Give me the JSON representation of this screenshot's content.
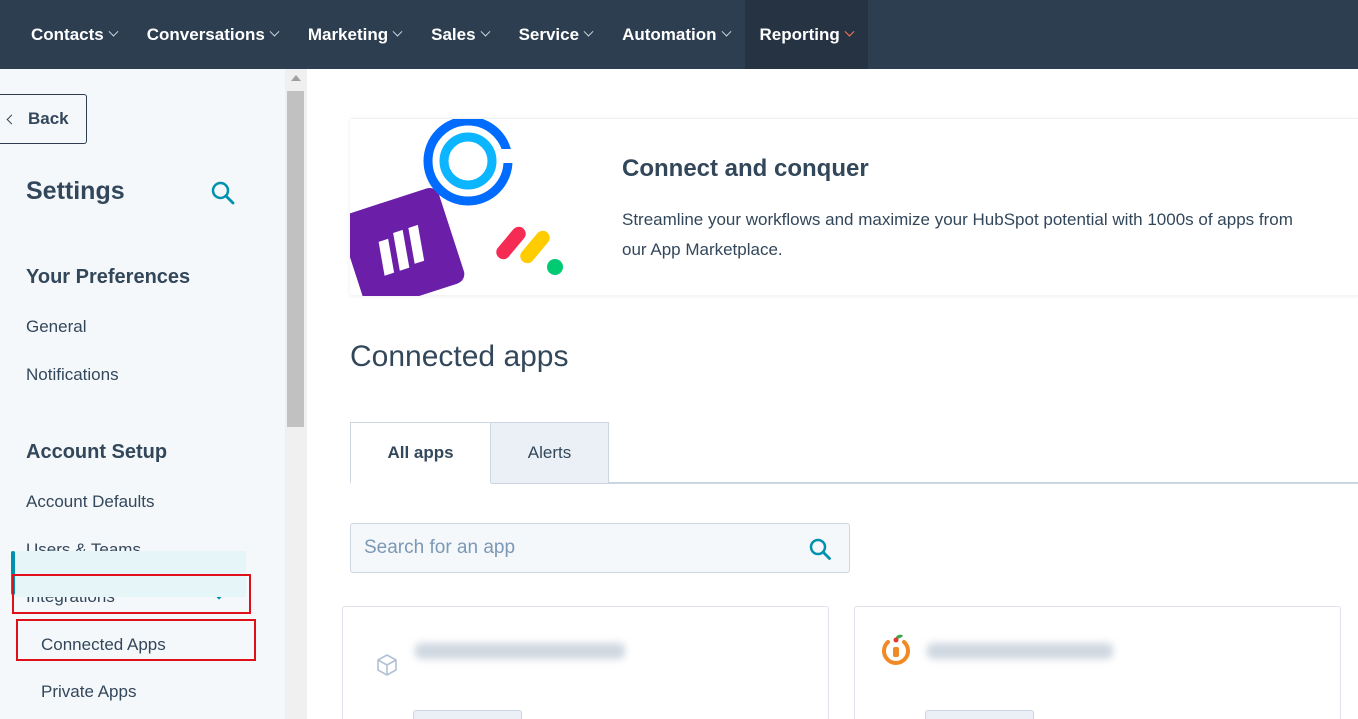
{
  "nav": {
    "items": [
      {
        "label": "Contacts"
      },
      {
        "label": "Conversations"
      },
      {
        "label": "Marketing"
      },
      {
        "label": "Sales"
      },
      {
        "label": "Service"
      },
      {
        "label": "Automation"
      },
      {
        "label": "Reporting"
      }
    ]
  },
  "sidebar": {
    "back_label": "Back",
    "title": "Settings",
    "sections": [
      {
        "heading": "Your Preferences",
        "links": [
          "General",
          "Notifications"
        ]
      },
      {
        "heading": "Account Setup",
        "links": [
          "Account Defaults",
          "Users & Teams",
          "Integrations"
        ]
      }
    ],
    "sub_links": [
      "Connected Apps",
      "Private Apps"
    ]
  },
  "banner": {
    "title": "Connect and conquer",
    "text": "Streamline your workflows and maximize your HubSpot potential with 1000s of apps from our App Marketplace."
  },
  "main": {
    "page_title": "Connected apps",
    "tabs": [
      {
        "label": "All apps"
      },
      {
        "label": "Alerts"
      }
    ],
    "search_placeholder": "Search for an app"
  },
  "colors": {
    "nav_bg": "#2d3e50",
    "accent_teal": "#0091ae",
    "highlight_red": "#e0101a",
    "active_chevron": "#ff7a59"
  }
}
